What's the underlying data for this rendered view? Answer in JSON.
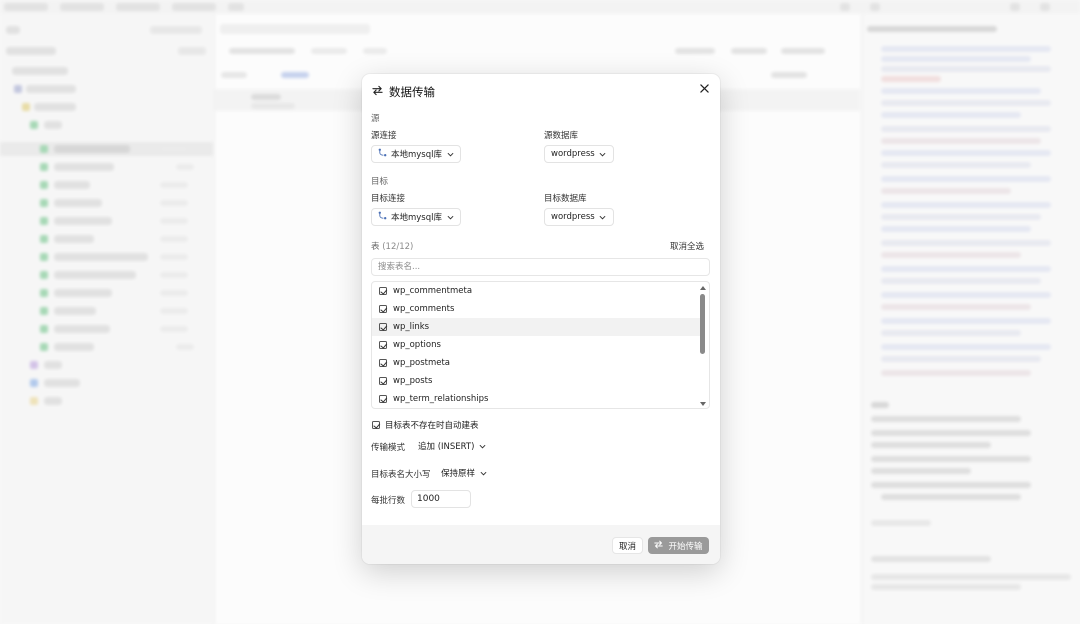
{
  "dialog": {
    "title": "数据传输",
    "title_icon": "transfer-arrows-icon",
    "close_icon": "close-icon",
    "source": {
      "section": "源",
      "connection_label": "源连接",
      "connection_value": "本地mysql库",
      "database_label": "源数据库",
      "database_value": "wordpress"
    },
    "target": {
      "section": "目标",
      "connection_label": "目标连接",
      "connection_value": "本地mysql库",
      "database_label": "目标数据库",
      "database_value": "wordpress"
    },
    "tables": {
      "label": "表",
      "count": "(12/12)",
      "deselect_all": "取消全选",
      "search_placeholder": "搜索表名...",
      "items": [
        "wp_commentmeta",
        "wp_comments",
        "wp_links",
        "wp_options",
        "wp_postmeta",
        "wp_posts",
        "wp_term_relationships"
      ],
      "highlighted_index": 2
    },
    "auto_create_label": "目标表不存在时自动建表",
    "transfer_mode_label": "传输模式",
    "transfer_mode_value": "追加 (INSERT)",
    "case_label": "目标表名大小写",
    "case_value": "保持原样",
    "batch_label": "每批行数",
    "batch_value": "1000",
    "cancel_label": "取消",
    "start_label": "开始传输"
  },
  "colors": {
    "dialog_bg": "#ffffff",
    "footer_bg": "#f5f5f5",
    "start_button": "#9a9a9a",
    "highlight_row": "#f2f2f2"
  }
}
